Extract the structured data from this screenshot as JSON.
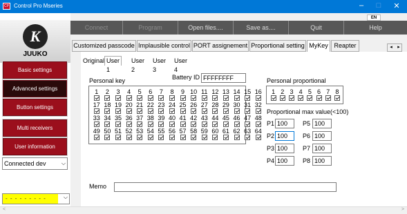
{
  "window": {
    "title": "Control Pro Mseries",
    "lang": "EN",
    "min": "–",
    "max": "□",
    "close": "✕"
  },
  "logo": {
    "mark": "K",
    "brand": "JUUKO"
  },
  "sidebar": {
    "items": [
      {
        "label": "Basic settings"
      },
      {
        "label": "Advanced settings"
      },
      {
        "label": "Button settings"
      },
      {
        "label": "Multi receivers"
      },
      {
        "label": "User information"
      }
    ]
  },
  "connection_select": {
    "value": "Connected dev"
  },
  "port_select": {
    "value": "- - - - - - - - -"
  },
  "toolbar": {
    "connect": "Connect",
    "program": "Program",
    "open": "Open files....",
    "save": "Save as....",
    "quit": "Quit",
    "help": "Help"
  },
  "tabs": [
    "Customized passcode",
    "Implausible control",
    "PORT assignement",
    "Proportional setting",
    "MyKey",
    "Reapter"
  ],
  "subtabs": [
    "Original",
    "User 1",
    "User 2",
    "User 3",
    "User 4"
  ],
  "personal_key": {
    "label": "Personal key",
    "battery_label": "Battery ID",
    "battery_value": "FFFFFFFF",
    "rows": [
      [
        "1",
        "2",
        "3",
        "4",
        "5",
        "6",
        "7",
        "8",
        "9",
        "10",
        "11",
        "12",
        "13",
        "14",
        "15",
        "16"
      ],
      [
        "17",
        "18",
        "19",
        "20",
        "21",
        "22",
        "23",
        "24",
        "25",
        "26",
        "27",
        "28",
        "29",
        "30",
        "31",
        "32"
      ],
      [
        "33",
        "34",
        "35",
        "36",
        "37",
        "38",
        "39",
        "40",
        "41",
        "42",
        "43",
        "44",
        "45",
        "46",
        "47",
        "48"
      ],
      [
        "49",
        "50",
        "51",
        "52",
        "53",
        "54",
        "55",
        "56",
        "57",
        "58",
        "59",
        "60",
        "61",
        "62",
        "63",
        "64"
      ]
    ]
  },
  "personal_proportional": {
    "label": "Personal  proportional",
    "numbers": [
      "1",
      "2",
      "3",
      "4",
      "5",
      "6",
      "7",
      "8"
    ],
    "max_label": "Proportional max value(<100)",
    "fields": [
      {
        "label": "P1",
        "value": "100"
      },
      {
        "label": "P5",
        "value": "100"
      },
      {
        "label": "P2",
        "value": "100"
      },
      {
        "label": "P6",
        "value": "100"
      },
      {
        "label": "P3",
        "value": "100"
      },
      {
        "label": "P7",
        "value": "100"
      },
      {
        "label": "P4",
        "value": "100"
      },
      {
        "label": "P8",
        "value": "100"
      }
    ]
  },
  "memo": {
    "label": "Memo",
    "value": ""
  },
  "scroll": {
    "left": "◂",
    "right": "▸",
    "status_left": "<",
    "status_right": ">"
  }
}
